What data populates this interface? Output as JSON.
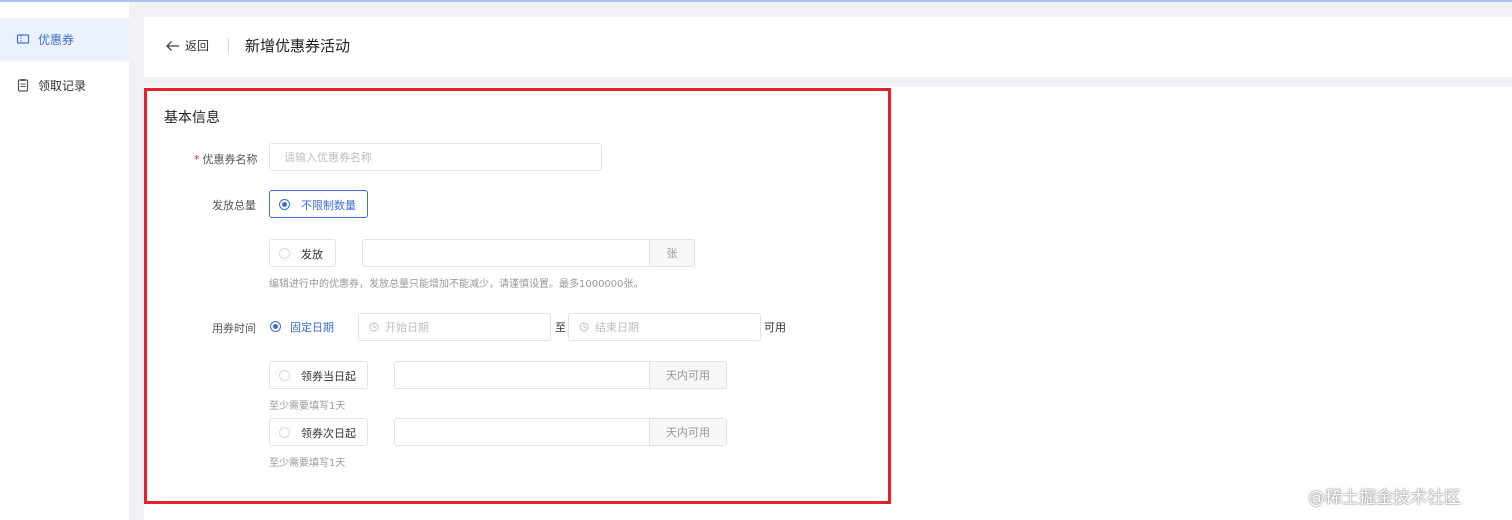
{
  "sidebar": {
    "items": [
      {
        "label": "优惠券",
        "icon": "ticket-icon",
        "active": true
      },
      {
        "label": "领取记录",
        "icon": "clipboard-icon",
        "active": false
      }
    ]
  },
  "header": {
    "back_label": "返回",
    "title": "新增优惠券活动"
  },
  "form": {
    "section_title": "基本信息",
    "name": {
      "label": "优惠券名称",
      "required_mark": "*",
      "placeholder": "请输入优惠券名称",
      "value": ""
    },
    "quantity": {
      "label": "发放总量",
      "option_unlimited": "不限制数量",
      "option_limited": "发放",
      "selected": "unlimited",
      "amount_value": "",
      "unit": "张",
      "hint": "编辑进行中的优惠券，发放总量只能增加不能减少，请谨慎设置。最多1000000张。"
    },
    "usage_time": {
      "label": "用券时间",
      "option_fixed": "固定日期",
      "start_placeholder": "开始日期",
      "separator": "至",
      "end_placeholder": "结束日期",
      "suffix": "可用",
      "option_same_day": "领券当日起",
      "same_day_value": "",
      "same_day_unit": "天内可用",
      "same_day_hint": "至少需要填写1天",
      "option_next_day": "领券次日起",
      "next_day_value": "",
      "next_day_unit": "天内可用",
      "next_day_hint": "至少需要填写1天",
      "selected": "fixed"
    }
  },
  "watermark": "@稀土掘金技术社区",
  "colors": {
    "accent": "#3c6fd7",
    "highlight_border": "#e0222b",
    "required": "#e0222b"
  }
}
